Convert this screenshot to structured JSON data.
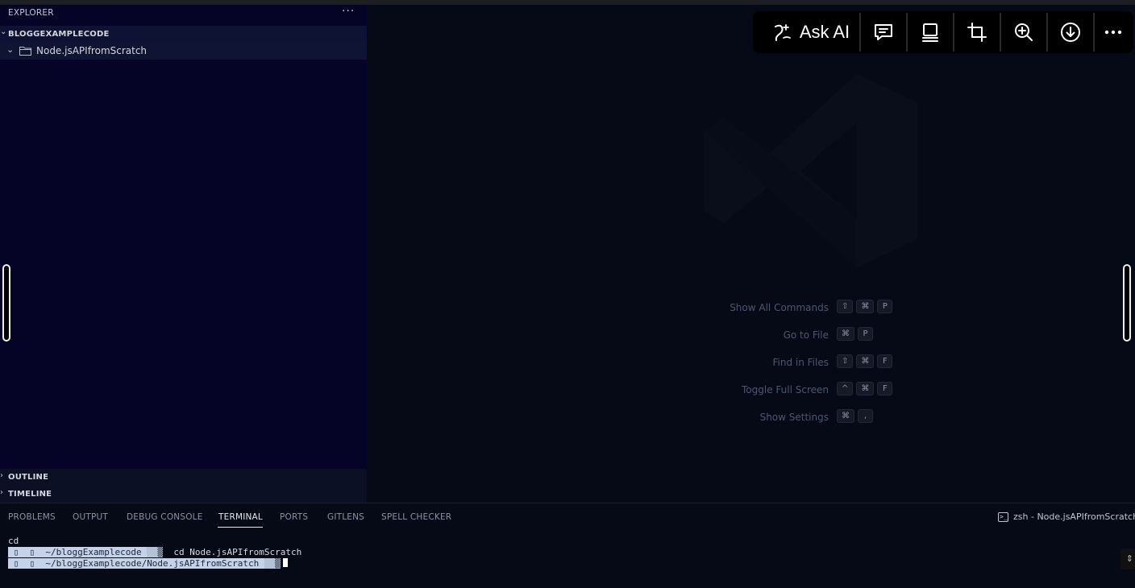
{
  "explorer": {
    "title": "EXPLORER",
    "more": "···",
    "workspace": "BLOGGEXAMPLECODE",
    "folder": "Node.jsAPIfromScratch"
  },
  "sections": {
    "outline": "OUTLINE",
    "timeline": "TIMELINE"
  },
  "toolbar": {
    "ask_ai": "Ask AI"
  },
  "shortcuts": [
    {
      "label": "Show All Commands",
      "keys": [
        "⇧",
        "⌘",
        "P"
      ]
    },
    {
      "label": "Go to File",
      "keys": [
        "⌘",
        "P"
      ]
    },
    {
      "label": "Find in Files",
      "keys": [
        "⇧",
        "⌘",
        "F"
      ]
    },
    {
      "label": "Toggle Full Screen",
      "keys": [
        "^",
        "⌘",
        "F"
      ]
    },
    {
      "label": "Show Settings",
      "keys": [
        "⌘",
        ","
      ]
    }
  ],
  "panel": {
    "tabs": [
      "PROBLEMS",
      "OUTPUT",
      "DEBUG CONSOLE",
      "TERMINAL",
      "PORTS",
      "GITLENS",
      "SPELL CHECKER"
    ],
    "active_tab": "TERMINAL",
    "terminal_title": "zsh - Node.jsAPIfromScratch"
  },
  "terminal": {
    "line1": "cd",
    "line2_prompt": "~/bloggExamplecode",
    "line2_cmd": "cd Node.jsAPIfromScratch",
    "line3_prompt": "~/bloggExamplecode/Node.jsAPIfromScratch"
  },
  "colors": {
    "sidebar_bg": "#050426",
    "editor_bg": "#060a16",
    "toolbar_bg": "#000000",
    "selection": "#c4d2ea"
  }
}
